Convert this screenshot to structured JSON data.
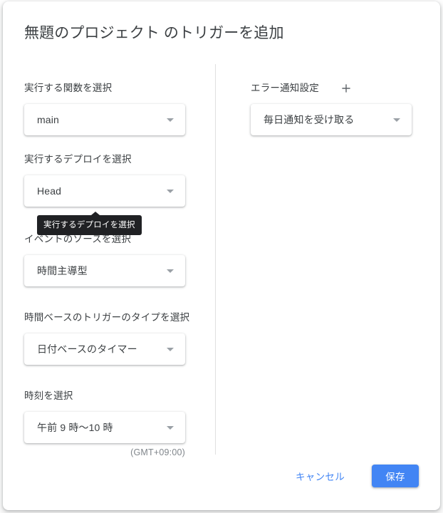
{
  "dialog": {
    "title": "無題のプロジェクト のトリガーを追加"
  },
  "left_column": {
    "fields": [
      {
        "label": "実行する関数を選択",
        "value": "main",
        "icon": "chevron-down-icon"
      },
      {
        "label": "実行するデプロイを選択",
        "value": "Head",
        "icon": "chevron-down-icon"
      },
      {
        "label": "イベントのソースを選択",
        "value": "時間主導型",
        "icon": "chevron-down-icon"
      },
      {
        "label": "時間ベースのトリガーのタイプを選択",
        "value": "日付ベースのタイマー",
        "icon": "chevron-down-icon"
      },
      {
        "label": "時刻を選択",
        "value": "午前 9 時〜10 時",
        "icon": "chevron-down-icon",
        "hint": "(GMT+09:00)"
      }
    ]
  },
  "right_column": {
    "label": "エラー通知設定",
    "add_icon": "plus-icon",
    "notification": {
      "value": "毎日通知を受け取る",
      "icon": "chevron-down-icon"
    }
  },
  "tooltip": {
    "text": "実行するデプロイを選択"
  },
  "footer": {
    "cancel_label": "キャンセル",
    "save_label": "保存"
  },
  "colors": {
    "accent": "#4285f4",
    "text_primary": "#3c4043",
    "text_secondary": "#80868b",
    "tooltip_bg": "#202124",
    "divider": "#e0e0e0"
  }
}
